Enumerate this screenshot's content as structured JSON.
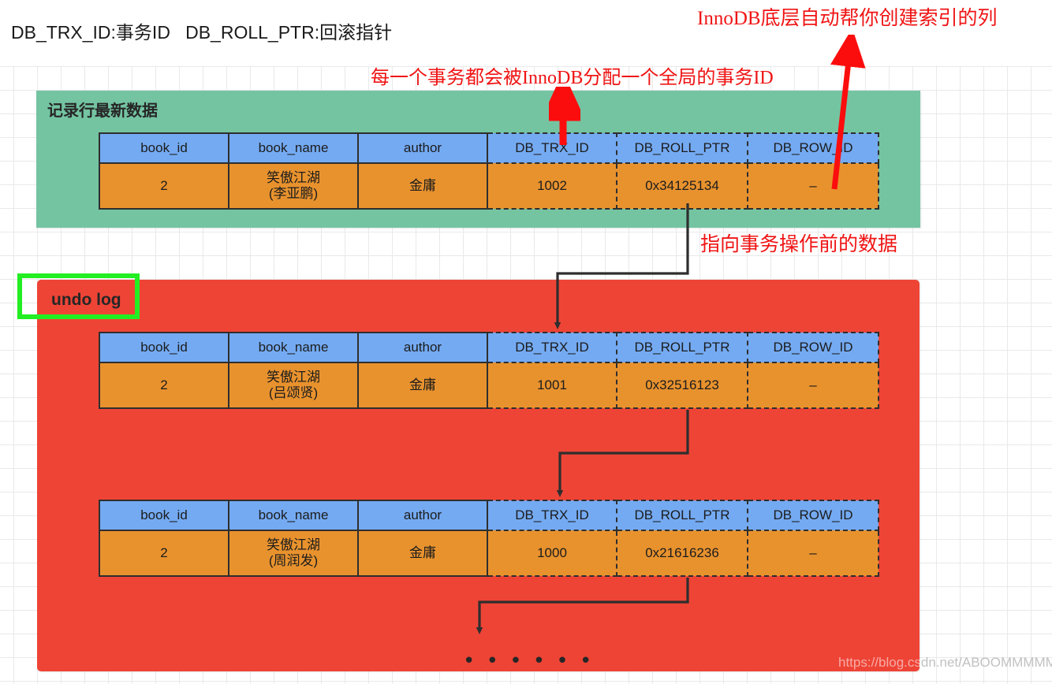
{
  "caption": {
    "legend_line": "DB_TRX_ID:事务ID   DB_ROLL_PTR:回滚指针"
  },
  "annotations": {
    "index_column": "InnoDB底层自动帮你创建索引的列",
    "global_trx_id": "每一个事务都会被InnoDB分配一个全局的事务ID",
    "point_before_data": "指向事务操作前的数据"
  },
  "panels": {
    "latest": {
      "title": "记录行最新数据",
      "color": "#74c4a2"
    },
    "undo": {
      "title": "undo log",
      "color": "#ee4436",
      "highlight_color": "#22ee22",
      "ellipsis": "• • • • • •"
    }
  },
  "table": {
    "columns": [
      "book_id",
      "book_name",
      "author",
      "DB_TRX_ID",
      "DB_ROLL_PTR",
      "DB_ROW_ID"
    ],
    "dashed_from_column_index": 3
  },
  "rows": {
    "latest": {
      "book_id": "2",
      "book_name_line1": "笑傲江湖",
      "book_name_line2": "(李亚鹏)",
      "author": "金庸",
      "db_trx_id": "1002",
      "db_roll_ptr": "0x34125134",
      "db_row_id": "–"
    },
    "undo_1": {
      "book_id": "2",
      "book_name_line1": "笑傲江湖",
      "book_name_line2": "(吕颂贤)",
      "author": "金庸",
      "db_trx_id": "1001",
      "db_roll_ptr": "0x32516123",
      "db_row_id": "–"
    },
    "undo_2": {
      "book_id": "2",
      "book_name_line1": "笑傲江湖",
      "book_name_line2": "(周润发)",
      "author": "金庸",
      "db_trx_id": "1000",
      "db_roll_ptr": "0x21616236",
      "db_row_id": "–"
    }
  },
  "watermark": {
    "text_on_red": "https://blog.cs",
    "text_on_white": "dn.net/ABOOMMMMM"
  },
  "colors": {
    "header_blue": "#74aaf2",
    "cell_orange": "#e8922e",
    "annotation_red": "#f01414",
    "border_dark": "#2e2e2e"
  }
}
